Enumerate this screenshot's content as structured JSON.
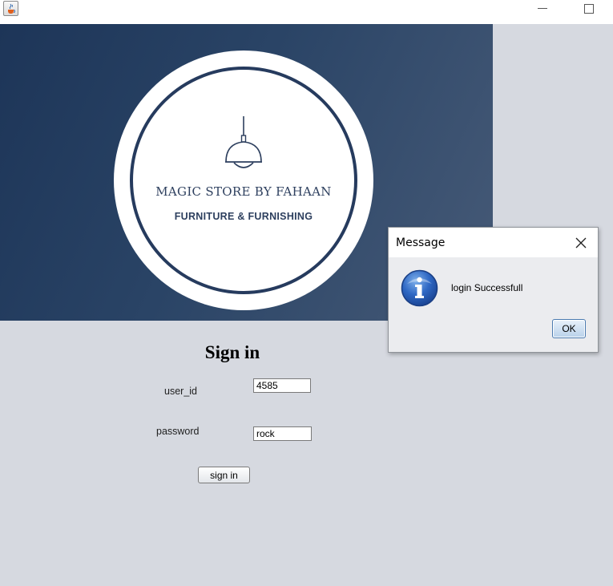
{
  "window": {
    "icons": {
      "app": "java-cup-icon",
      "minimize": "minimize-icon",
      "maximize": "maximize-icon"
    }
  },
  "banner": {
    "logo_icon": "pendant-lamp-icon",
    "brand_name": "MAGIC STORE BY FAHAAN",
    "brand_tagline": "FURNITURE & FURNISHING",
    "colors": {
      "gradient_start": "#1d3558",
      "gradient_end": "#465a77",
      "ring": "#263b5e"
    }
  },
  "form": {
    "heading": "Sign in",
    "user_id_label": "user_id",
    "user_id_value": "4585",
    "password_label": "password",
    "password_value": "rock",
    "submit_label": "sign in"
  },
  "dialog": {
    "title": "Message",
    "icon": "info-icon",
    "message": "login Successfull",
    "ok_label": "OK",
    "close_icon": "close-icon"
  },
  "colors": {
    "background": "#d6d9e0"
  }
}
